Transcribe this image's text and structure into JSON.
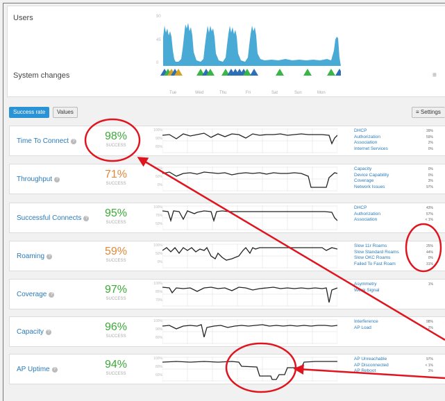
{
  "top": {
    "users_label": "Users",
    "changes_label": "System changes",
    "y_ticks": [
      "90",
      "45",
      "0"
    ],
    "days": [
      "Tue",
      "Wed",
      "Thu",
      "Fri",
      "Sat",
      "Sun",
      "Mon"
    ],
    "filter_icon": "≡"
  },
  "toolbar": {
    "success_rate": "Success rate",
    "values": "Values",
    "settings": "Settings",
    "settings_icon": "≡"
  },
  "rows": [
    {
      "name": "Time To Connect",
      "pct": "98%",
      "success": "success",
      "color": "#3aaa35",
      "yticks": [
        "100%",
        "90%",
        "80%"
      ],
      "reasons": [
        {
          "label": "DHCP",
          "value": "39%"
        },
        {
          "label": "Authorization",
          "value": "59%"
        },
        {
          "label": "Association",
          "value": "2%"
        },
        {
          "label": "Internet Services",
          "value": "0%"
        }
      ]
    },
    {
      "name": "Throughput",
      "pct": "71%",
      "success": "success",
      "color": "#e0883a",
      "yticks": [
        "100%",
        "50%",
        "0%"
      ],
      "reasons": [
        {
          "label": "Capacity",
          "value": "0%"
        },
        {
          "label": "Device Capability",
          "value": "0%"
        },
        {
          "label": "Coverage",
          "value": "3%"
        },
        {
          "label": "Network Issues",
          "value": "97%"
        }
      ]
    },
    {
      "name": "Successful Connects",
      "pct": "95%",
      "success": "success",
      "color": "#3aaa35",
      "yticks": [
        "100%",
        "75%",
        "50%"
      ],
      "reasons": [
        {
          "label": "DHCP",
          "value": "43%"
        },
        {
          "label": "Authorization",
          "value": "57%"
        },
        {
          "label": "Association",
          "value": "< 1%"
        }
      ]
    },
    {
      "name": "Roaming",
      "pct": "59%",
      "success": "success",
      "color": "#e0883a",
      "yticks": [
        "100%",
        "50%",
        "0%"
      ],
      "reasons": [
        {
          "label": "Slow 11r Roams",
          "value": "25%"
        },
        {
          "label": "Slow Standard Roams",
          "value": "44%"
        },
        {
          "label": "Slow OKC Roams",
          "value": "0%"
        },
        {
          "label": "Failed To Fast Roam",
          "value": "31%"
        }
      ]
    },
    {
      "name": "Coverage",
      "pct": "97%",
      "success": "success",
      "color": "#3aaa35",
      "yticks": [
        "100%",
        "85%",
        "70%"
      ],
      "reasons": [
        {
          "label": "Asymmetry",
          "value": "1%"
        },
        {
          "label": "Weak Signal",
          "value": ""
        }
      ]
    },
    {
      "name": "Capacity",
      "pct": "96%",
      "success": "success",
      "color": "#3aaa35",
      "yticks": [
        "100%",
        "90%",
        "80%"
      ],
      "reasons": [
        {
          "label": "Interference",
          "value": "98%"
        },
        {
          "label": "AP Load",
          "value": "2%"
        }
      ]
    },
    {
      "name": "AP Uptime",
      "pct": "94%",
      "success": "success",
      "color": "#3aaa35",
      "yticks": [
        "100%",
        "80%",
        "60%"
      ],
      "reasons": [
        {
          "label": "AP Unreachable",
          "value": "97%"
        },
        {
          "label": "AP Disconnected",
          "value": "< 1%"
        },
        {
          "label": "AP Reboot",
          "value": "3%"
        }
      ]
    }
  ],
  "colors": {
    "accent": "#2a93d5",
    "good": "#3aaa35",
    "warn": "#e0883a",
    "annotation": "#e0141e",
    "users_chart": "#4aaad6"
  }
}
